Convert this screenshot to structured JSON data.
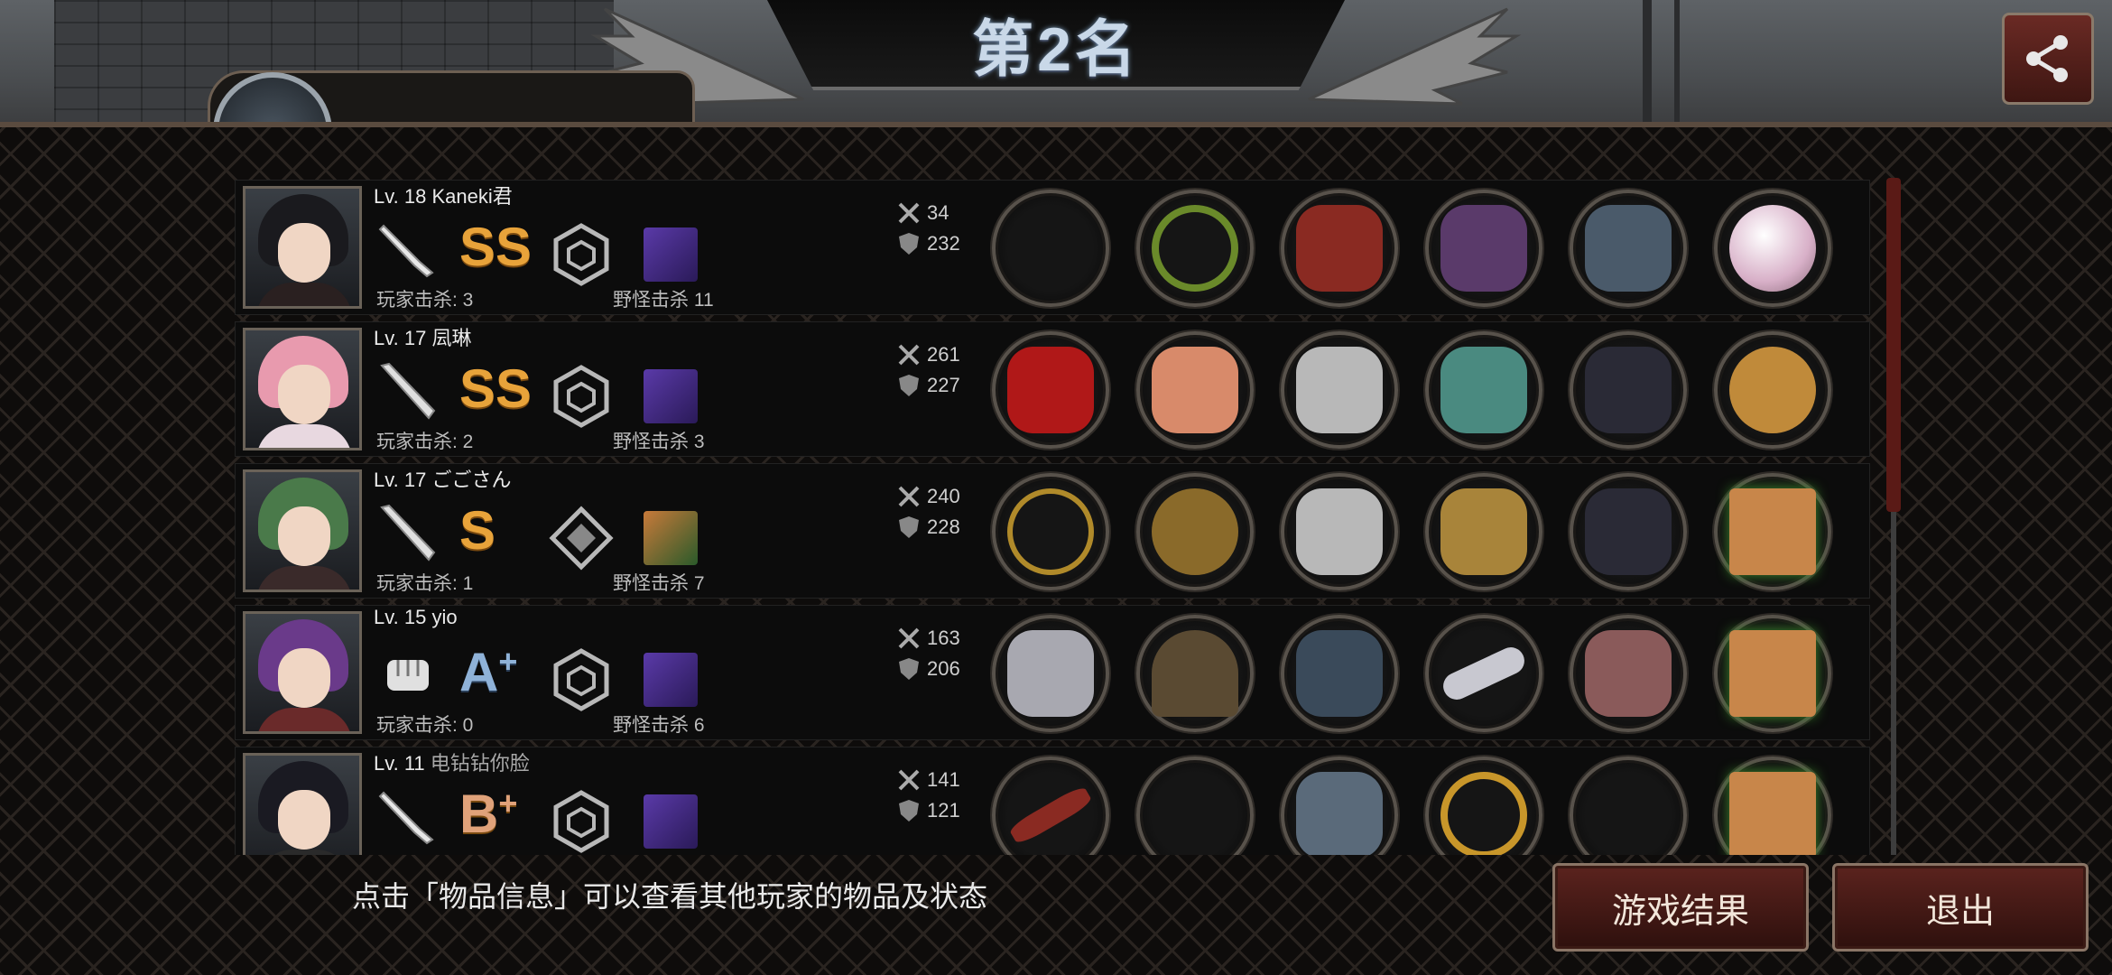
{
  "title": "第2名",
  "partial_header_text": "Kaneki君",
  "hint": "点击「物品信息」可以查看其他玩家的物品及状态",
  "buttons": {
    "result": "游戏结果",
    "exit": "退出"
  },
  "players": [
    {
      "level": "Lv. 18",
      "name": "Kaneki君",
      "rank": "SS",
      "rank_sup": "",
      "weapon": "knife",
      "player_kills": "玩家击杀: 3",
      "monster_kills": "野怪击杀 11",
      "attack": "34",
      "defense": "232",
      "gear_colors": [
        "",
        "#6a8a2a",
        "#8a2a22",
        "#5a3a6a",
        "#4a5a6a",
        "#d8b0c8"
      ]
    },
    {
      "level": "Lv. 17",
      "name": "凨琳",
      "rank": "SS",
      "rank_sup": "",
      "weapon": "bat",
      "player_kills": "玩家击杀: 2",
      "monster_kills": "野怪击杀 3",
      "attack": "261",
      "defense": "227",
      "gear_colors": [
        "#b01818",
        "#d88a6a",
        "#b8b8b8",
        "#4a8a80",
        "#2a2a36",
        "#c08a3a"
      ]
    },
    {
      "level": "Lv. 17",
      "name": "ごごさん",
      "rank": "S",
      "rank_sup": "",
      "weapon": "bat",
      "player_kills": "玩家击杀: 1",
      "monster_kills": "野怪击杀 7",
      "attack": "240",
      "defense": "228",
      "gear_colors": [
        "#b08a2a",
        "#8a6a2a",
        "#b8b8b8",
        "#a8843a",
        "#2a2a36",
        "#c8864a"
      ]
    },
    {
      "level": "Lv. 15",
      "name": "yio",
      "rank": "A",
      "rank_sup": "+",
      "weapon": "fist",
      "player_kills": "玩家击杀: 0",
      "monster_kills": "野怪击杀 6",
      "attack": "163",
      "defense": "206",
      "gear_colors": [
        "#a8a8b0",
        "#5a4a32",
        "#3a4a5a",
        "#c8c8d0",
        "#8a5a5a",
        "#c8864a"
      ]
    },
    {
      "level": "Lv. 11",
      "name": "电钻钻你脸",
      "rank": "B",
      "rank_sup": "+",
      "weapon": "knife",
      "player_kills": "",
      "monster_kills": "",
      "attack": "141",
      "defense": "121",
      "gear_colors": [
        "#8a2a22",
        "",
        "#5a6a7a",
        "#c8962a",
        "",
        "#c8864a"
      ]
    }
  ],
  "colors": {
    "accent": "#5b231e",
    "gold_rank": "#e8a33a",
    "blue_rank": "#8fb2d8"
  }
}
